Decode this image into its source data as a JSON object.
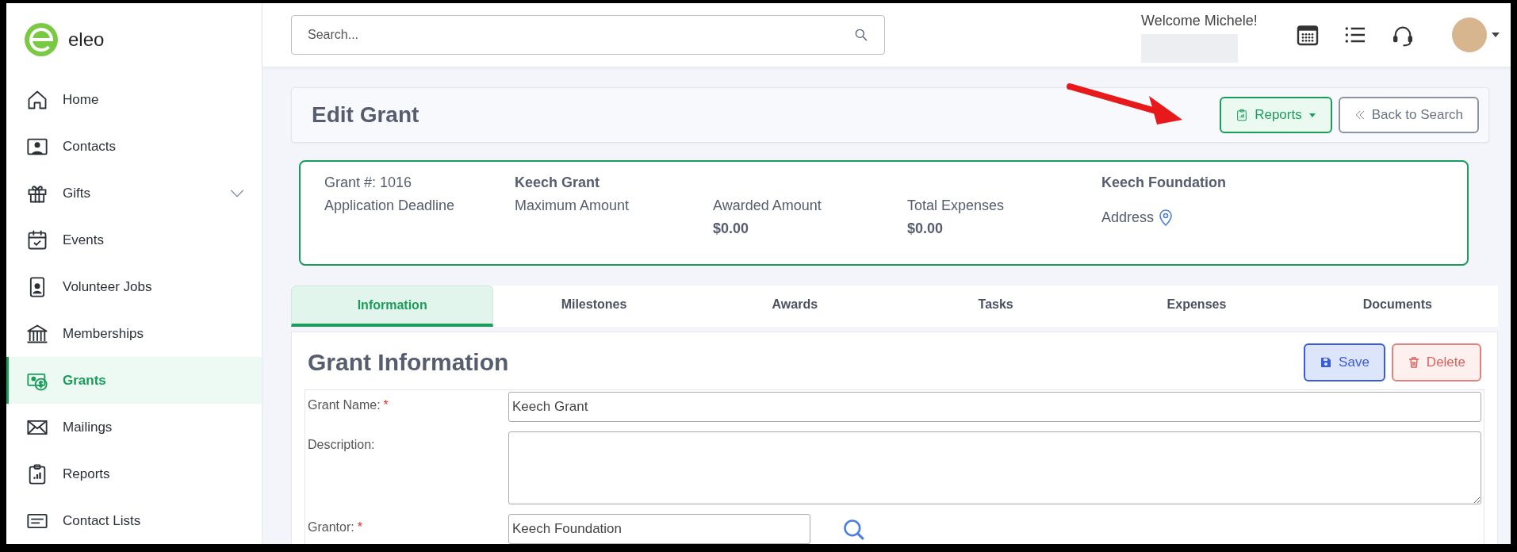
{
  "brand": {
    "name": "eleo"
  },
  "sidebar": {
    "items": [
      {
        "label": "Home",
        "selected": false,
        "has_submenu": false
      },
      {
        "label": "Contacts",
        "selected": false,
        "has_submenu": false
      },
      {
        "label": "Gifts",
        "selected": false,
        "has_submenu": true
      },
      {
        "label": "Events",
        "selected": false,
        "has_submenu": false
      },
      {
        "label": "Volunteer Jobs",
        "selected": false,
        "has_submenu": false
      },
      {
        "label": "Memberships",
        "selected": false,
        "has_submenu": false
      },
      {
        "label": "Grants",
        "selected": true,
        "has_submenu": false
      },
      {
        "label": "Mailings",
        "selected": false,
        "has_submenu": false
      },
      {
        "label": "Reports",
        "selected": false,
        "has_submenu": false
      },
      {
        "label": "Contact Lists",
        "selected": false,
        "has_submenu": false
      }
    ]
  },
  "header": {
    "search": {
      "placeholder": "Search..."
    },
    "welcome": "Welcome Michele!"
  },
  "page": {
    "title": "Edit Grant",
    "buttons": [
      {
        "kind": "dropdown",
        "label": "Reports"
      },
      {
        "kind": "back",
        "label": "Back to Search"
      }
    ]
  },
  "summary": {
    "grant_number": "Grant #: 1016",
    "grant_name": "Keech Grant",
    "application_deadline": "Application Deadline",
    "maximum_amount": "Maximum Amount",
    "awarded_amount": {
      "label": "Awarded Amount",
      "value": "$0.00"
    },
    "total_expenses": {
      "label": "Total Expenses",
      "value": "$0.00"
    },
    "grantor": "Keech Foundation",
    "address": "Address"
  },
  "tabs": [
    {
      "label": "Information",
      "selected": true
    },
    {
      "label": "Milestones",
      "selected": false
    },
    {
      "label": "Awards",
      "selected": false
    },
    {
      "label": "Tasks",
      "selected": false
    },
    {
      "label": "Expenses",
      "selected": false
    },
    {
      "label": "Documents",
      "selected": false
    }
  ],
  "section": {
    "title": "Grant Information",
    "actions": [
      {
        "kind": "save",
        "label": "Save"
      },
      {
        "kind": "delete",
        "label": "Delete"
      }
    ]
  },
  "form": {
    "fields": [
      {
        "kind": "text",
        "label": "Grant Name:",
        "required_mark": "*",
        "value": "Keech Grant"
      },
      {
        "kind": "textarea",
        "label": "Description:"
      },
      {
        "kind": "lookup",
        "label": "Grantor:",
        "required_mark": "*",
        "value": "Keech Foundation"
      }
    ]
  }
}
